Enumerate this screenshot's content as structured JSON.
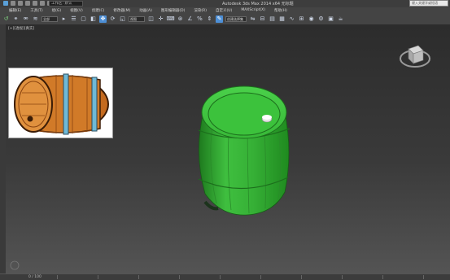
{
  "window": {
    "title": "Autodesk 3ds Max  2014 x64    无标题"
  },
  "quick_access": {
    "workspace_label": "工作区: 默认"
  },
  "search": {
    "placeholder": "键入关键字或短语"
  },
  "menu": {
    "items": [
      "编辑(E)",
      "工具(T)",
      "组(G)",
      "视图(V)",
      "创建(C)",
      "修改器(M)",
      "动画(A)",
      "图形编辑器(D)",
      "渲染(R)",
      "自定义(U)",
      "MAXScript(X)",
      "帮助(H)"
    ]
  },
  "toolbar": {
    "selection_filter": "全部",
    "reference_coord": "视图",
    "named_selection": "创建选择集"
  },
  "viewport": {
    "label": "[+][透视][真实]"
  },
  "reference_image": {
    "subject": "wooden barrel illustration"
  },
  "model": {
    "color": "#3fbf3f",
    "shape": "barrel"
  },
  "status": {
    "frame_counter": "0 / 100"
  },
  "colors": {
    "accent": "#4d8fd6",
    "model_green": "#3fbf3f"
  }
}
